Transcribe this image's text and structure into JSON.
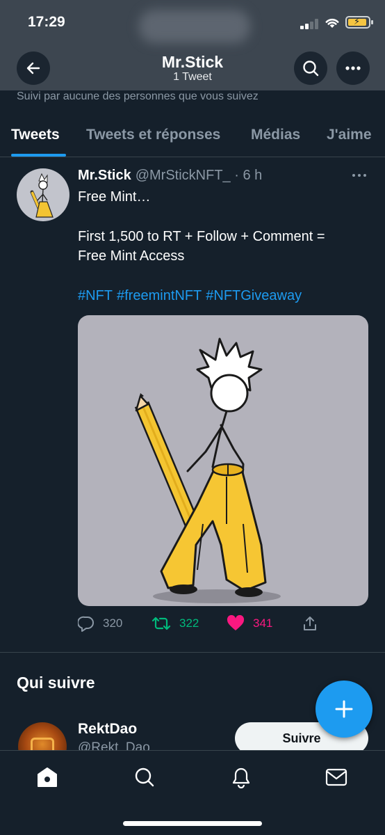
{
  "status": {
    "time": "17:29"
  },
  "header": {
    "title": "Mr.Stick",
    "subtitle": "1 Tweet",
    "followed_note": "Suivi par aucune des personnes que vous suivez"
  },
  "tabs": [
    {
      "label": "Tweets",
      "active": true
    },
    {
      "label": "Tweets et réponses",
      "active": false
    },
    {
      "label": "Médias",
      "active": false
    },
    {
      "label": "J'aime",
      "active": false
    }
  ],
  "tweet": {
    "name": "Mr.Stick",
    "handle": "@MrStickNFT_",
    "time": " · 6 h",
    "lines": [
      "Free Mint…",
      "First 1,500 to RT + Follow + Comment =",
      "Free Mint Access"
    ],
    "hashtags": [
      "#NFT",
      "#freemintNFT",
      "#NFTGiveaway"
    ],
    "stats": {
      "replies": "320",
      "retweets": "322",
      "likes": "341"
    }
  },
  "who_to_follow": {
    "title": "Qui suivre",
    "account": {
      "name": "RektDao",
      "handle": "@Rekt_Dao"
    },
    "follow_label": "Suivre"
  },
  "colors": {
    "accent": "#1d9bf0",
    "retweet": "#00ba7c",
    "like": "#f91880",
    "background": "#15202b"
  }
}
